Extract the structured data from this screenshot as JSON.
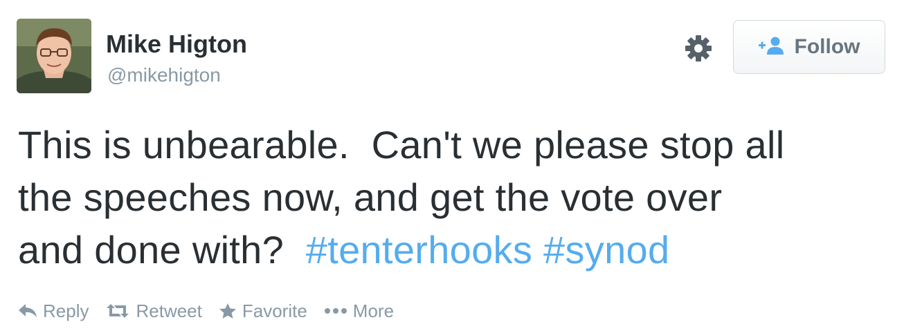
{
  "user": {
    "name": "Mike Higton",
    "handle": "@mikehigton"
  },
  "follow_button": {
    "label": "Follow",
    "icon": "add-user-icon"
  },
  "settings_icon": "gear-icon",
  "tweet": {
    "text_lines": [
      "This is unbearable.  Can't we please stop all",
      "the speeches now, and get the vote over",
      "and done with?  "
    ],
    "hashtags": [
      "#tenterhooks",
      "#synod"
    ]
  },
  "actions": [
    {
      "label": "Reply",
      "icon": "reply-icon"
    },
    {
      "label": "Retweet",
      "icon": "retweet-icon"
    },
    {
      "label": "Favorite",
      "icon": "star-icon"
    },
    {
      "label": "More",
      "icon": "more-dots-icon"
    }
  ],
  "colors": {
    "text": "#292f33",
    "muted": "#8899a6",
    "link": "#55acee"
  }
}
